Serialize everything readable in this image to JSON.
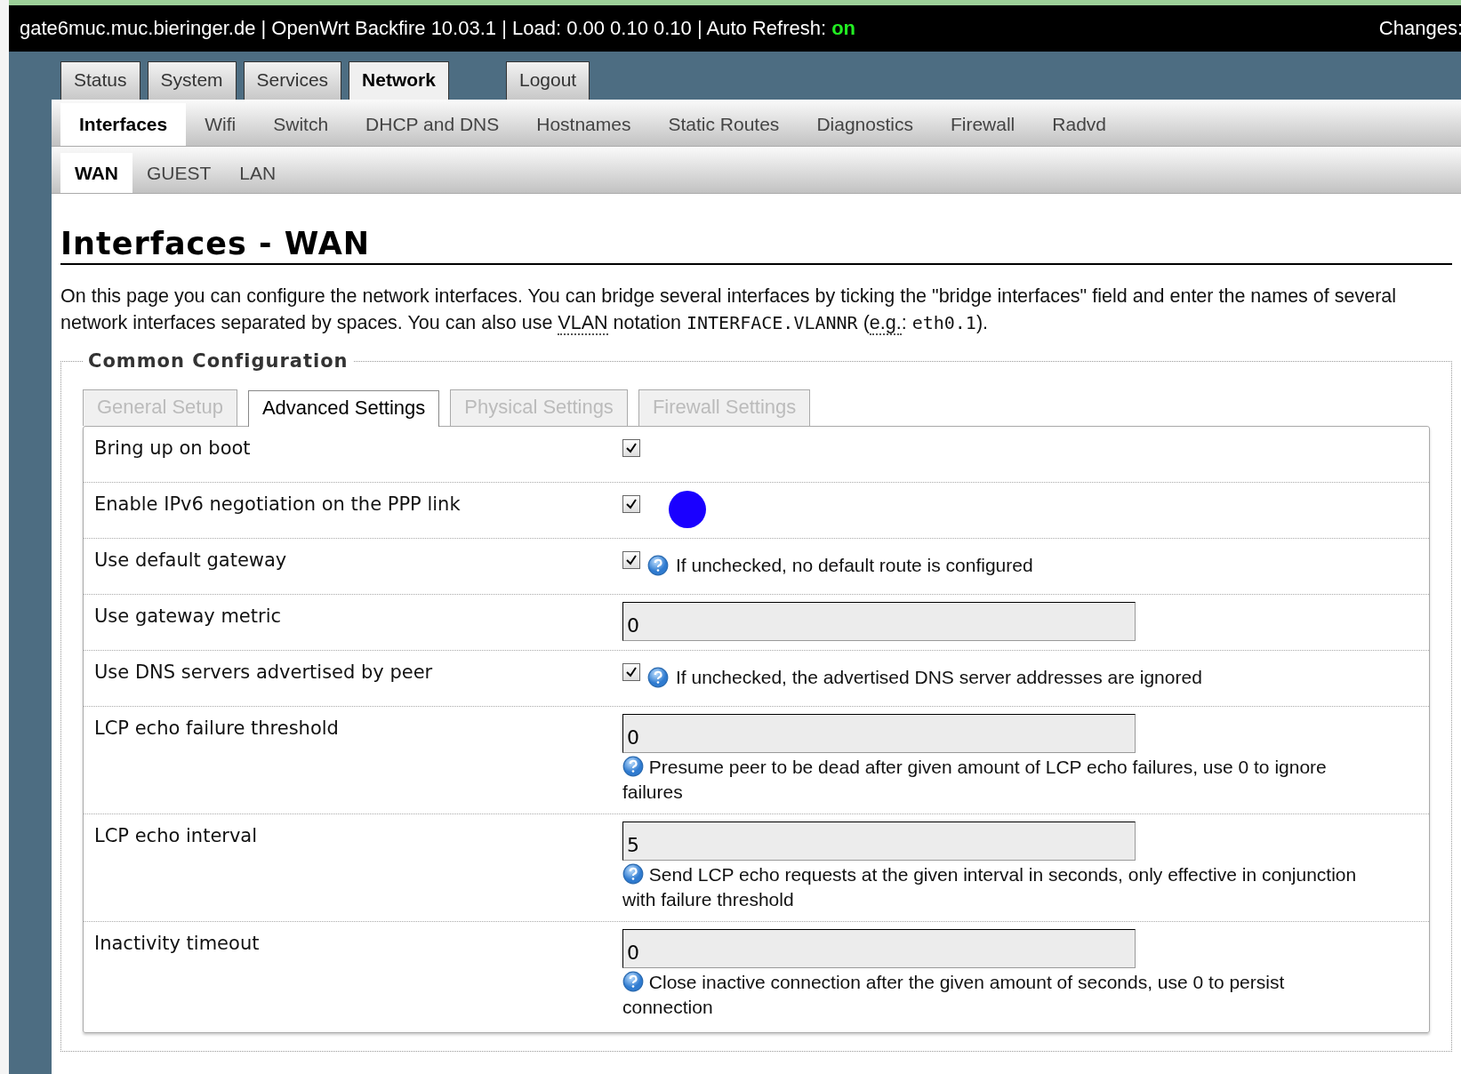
{
  "header": {
    "status": "gate6muc.muc.bieringer.de | OpenWrt Backfire 10.03.1 | Load: 0.00 0.10 0.10 | Auto Refresh:",
    "refresh_state": "on",
    "changes": "Changes:"
  },
  "main_tabs": [
    {
      "label": "Status",
      "selected": false
    },
    {
      "label": "System",
      "selected": false
    },
    {
      "label": "Services",
      "selected": false
    },
    {
      "label": "Network",
      "selected": true
    },
    {
      "label": "Logout",
      "selected": false,
      "kind": "logout"
    }
  ],
  "sub_tabs": [
    {
      "label": "Interfaces",
      "selected": true
    },
    {
      "label": "Wifi",
      "selected": false
    },
    {
      "label": "Switch",
      "selected": false
    },
    {
      "label": "DHCP and DNS",
      "selected": false
    },
    {
      "label": "Hostnames",
      "selected": false
    },
    {
      "label": "Static Routes",
      "selected": false
    },
    {
      "label": "Diagnostics",
      "selected": false
    },
    {
      "label": "Firewall",
      "selected": false
    },
    {
      "label": "Radvd",
      "selected": false
    }
  ],
  "interface_tabs": [
    {
      "label": "WAN",
      "selected": true
    },
    {
      "label": "GUEST",
      "selected": false
    },
    {
      "label": "LAN",
      "selected": false
    }
  ],
  "title": "Interfaces - WAN",
  "description": [
    {
      "kind": "plain",
      "text": "On this page you can configure the network interfaces. You can bridge several interfaces by ticking the \"bridge interfaces\" field and enter the names of several network interfaces separated by spaces. You can also use "
    },
    {
      "kind": "abbr",
      "text": "VLAN"
    },
    {
      "kind": "plain",
      "text": " notation "
    },
    {
      "kind": "code",
      "text": "INTERFACE.VLANNR"
    },
    {
      "kind": "plain",
      "text": " ("
    },
    {
      "kind": "abbr",
      "text": "e.g."
    },
    {
      "kind": "plain",
      "text": ": "
    },
    {
      "kind": "code",
      "text": "eth0.1"
    },
    {
      "kind": "plain",
      "text": ")."
    }
  ],
  "section": {
    "legend": "Common Configuration",
    "tabs": [
      {
        "label": "General Setup",
        "selected": false
      },
      {
        "label": "Advanced Settings",
        "selected": true
      },
      {
        "label": "Physical Settings",
        "selected": false
      },
      {
        "label": "Firewall Settings",
        "selected": false
      }
    ],
    "rows": [
      {
        "label": "Bring up on boot",
        "kind": "checkbox",
        "checked": true
      },
      {
        "label": "Enable IPv6 negotiation on the PPP link",
        "kind": "checkbox",
        "checked": true,
        "color": "#1a00ff"
      },
      {
        "label": "Use default gateway",
        "kind": "checkbox",
        "checked": true,
        "hint": "If unchecked, no default route is configured"
      },
      {
        "label": "Use gateway metric",
        "kind": "text",
        "value": "0"
      },
      {
        "label": "Use DNS servers advertised by peer",
        "kind": "checkbox",
        "checked": true,
        "hint": "If unchecked, the advertised DNS server addresses are ignored"
      },
      {
        "label": "LCP echo failure threshold",
        "kind": "text",
        "value": "0",
        "hint": "Presume peer to be dead after given amount of LCP echo failures, use 0 to ignore failures"
      },
      {
        "label": "LCP echo interval",
        "kind": "text",
        "value": "5",
        "hint": "Send LCP echo requests at the given interval in seconds, only effective in conjunction with failure threshold"
      },
      {
        "label": "Inactivity timeout",
        "kind": "text",
        "value": "0",
        "hint": "Close inactive connection after the given amount of seconds, use 0 to persist connection"
      }
    ]
  }
}
